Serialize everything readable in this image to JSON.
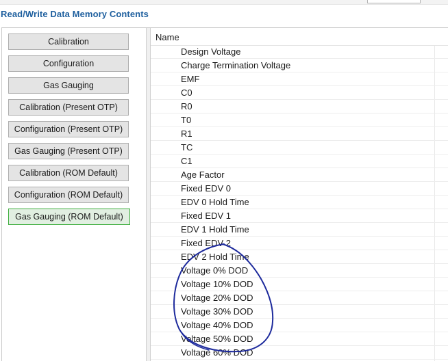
{
  "title": "Read/Write Data Memory Contents",
  "sidebar": {
    "buttons": [
      {
        "label": "Calibration",
        "active": false
      },
      {
        "label": "Configuration",
        "active": false
      },
      {
        "label": "Gas Gauging",
        "active": false
      },
      {
        "label": "Calibration (Present OTP)",
        "active": false
      },
      {
        "label": "Configuration (Present OTP)",
        "active": false
      },
      {
        "label": "Gas Gauging (Present OTP)",
        "active": false
      },
      {
        "label": "Calibration (ROM Default)",
        "active": false
      },
      {
        "label": "Configuration (ROM Default)",
        "active": false
      },
      {
        "label": "Gas Gauging (ROM Default)",
        "active": true
      }
    ]
  },
  "list": {
    "header": "Name",
    "rows": [
      "Design Voltage",
      "Charge Termination Voltage",
      "EMF",
      "C0",
      "R0",
      "T0",
      "R1",
      "TC",
      "C1",
      "Age Factor",
      "Fixed EDV 0",
      "EDV 0 Hold Time",
      "Fixed EDV 1",
      "EDV 1 Hold Time",
      "Fixed EDV 2",
      "EDV 2 Hold Time",
      "Voltage 0% DOD",
      "Voltage 10% DOD",
      "Voltage 20% DOD",
      "Voltage 30% DOD",
      "Voltage 40% DOD",
      "Voltage 50% DOD",
      "Voltage 60% DOD"
    ]
  },
  "colors": {
    "title": "#1e5f9e",
    "active_border": "#3cad3c",
    "annotation_ink": "#1d2a9c"
  }
}
